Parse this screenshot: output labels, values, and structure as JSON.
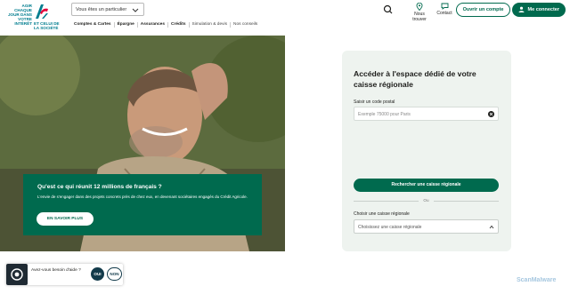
{
  "header": {
    "logo_tagline_left": "AGIR CHAQUE JOUR DANS VOTRE INTÉRÊT",
    "logo_tagline_right": "ET CELUI DE LA SOCIÉTÉ",
    "profile_select": "Vous êtes un particulier",
    "nav": [
      "Comptes & Cartes",
      "Épargne",
      "Assurances",
      "Crédits",
      "Simulation & devis",
      "Nos conseils"
    ],
    "find_us": "Nous trouver",
    "contact": "Contact",
    "open_account": "Ouvrir un compte",
    "my_account": "Me connecter",
    "brand_color": "#006a4e"
  },
  "promo": {
    "title": "Qu'est ce qui réunit 12 millions de français ?",
    "text": "L'envie de s'engager dans des projets concrets près de chez eux, en devenant sociétaires engagés du Crédit Agricole.",
    "cta": "EN SAVOIR PLUS"
  },
  "regional": {
    "title": "Accéder à l'espace dédié de votre caisse régionale",
    "postal_label": "Saisir un code postal",
    "postal_placeholder": "Exemple 75000 pour Paris",
    "search_button": "Rechercher une caisse régionale",
    "or": "Ou",
    "choose_label": "Choisir une caisse régionale",
    "choose_placeholder": "Choisissez une caisse régionale"
  },
  "help_widget": {
    "question": "Avez-vous besoin d'aide ?",
    "yes": "OUI",
    "no": "NON"
  },
  "watermark": "ScanMalware"
}
